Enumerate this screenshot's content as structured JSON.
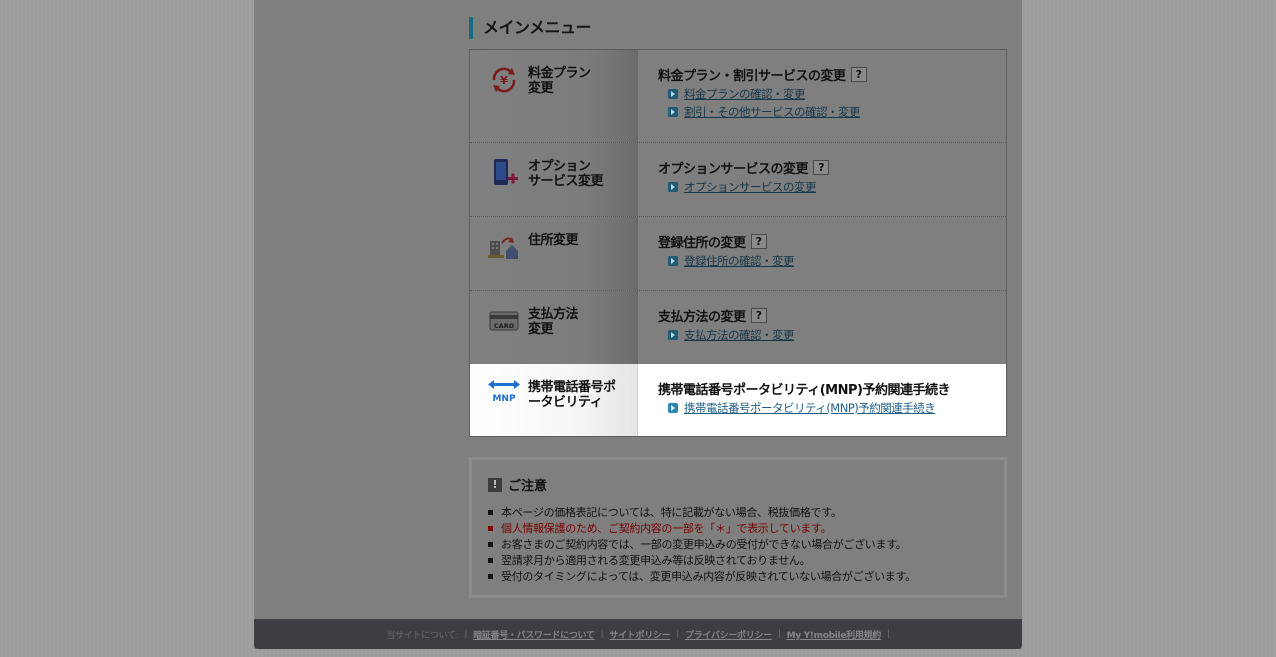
{
  "section_title": "メインメニュー",
  "menu": [
    {
      "icon": "yen-change-icon",
      "name_lines": [
        "料金プラン",
        "変更"
      ],
      "heading": "料金プラン・割引サービスの変更",
      "help": "?",
      "links": [
        "料金プランの確認・変更",
        "割引・その他サービスの確認・変更"
      ]
    },
    {
      "icon": "phone-plus-icon",
      "name_lines": [
        "オプション",
        "サービス変更"
      ],
      "heading": "オプションサービスの変更",
      "help": "?",
      "links": [
        "オプションサービスの変更"
      ]
    },
    {
      "icon": "house-move-icon",
      "name_lines": [
        "住所変更"
      ],
      "heading": "登録住所の変更",
      "help": "?",
      "links": [
        "登録住所の確認・変更"
      ]
    },
    {
      "icon": "card-icon",
      "icon_text": "CARD",
      "name_lines": [
        "支払方法",
        "変更"
      ],
      "heading": "支払方法の変更",
      "help": "?",
      "links": [
        "支払方法の確認・変更"
      ]
    },
    {
      "icon": "mnp-icon",
      "icon_text": "MNP",
      "name_lines": [
        "携帯電話番号ポ",
        "ータビリティ"
      ],
      "heading": "携帯電話番号ポータビリティ(MNP)予約関連手続き",
      "links": [
        "携帯電話番号ポータビリティ(MNP)予約関連手続き"
      ]
    }
  ],
  "notice": {
    "title": "ご注意",
    "icon_text": "!",
    "items": [
      "本ページの価格表記については、特に記載がない場合、税抜価格です。",
      "個人情報保護のため、ご契約内容の一部を「＊」で表示しています。",
      "お客さまのご契約内容では、一部の変更申込みの受付ができない場合がございます。",
      "翌請求月から適用される変更申込み等は反映されておりません。",
      "受付のタイミングによっては、変更申込み内容が反映されていない場合がございます。"
    ]
  },
  "footer": {
    "label": "当サイトについて:",
    "links": [
      "暗証番号・パスワードについて",
      "サイトポリシー",
      "プライバシーポリシー",
      "My Y!mobile利用規約"
    ],
    "separator": "|"
  },
  "colors": {
    "accent": "#1a6c86",
    "link": "#15374a",
    "warning": "#7a0000",
    "overlay": "#7f7f7f"
  }
}
